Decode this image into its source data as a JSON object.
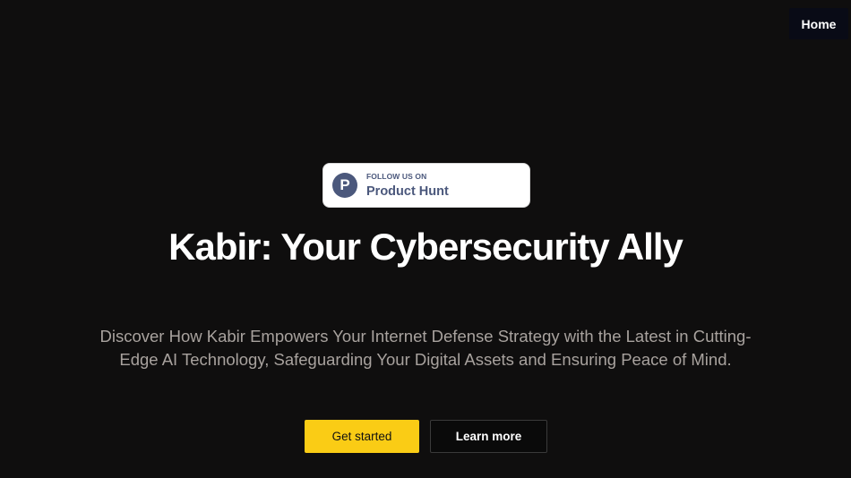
{
  "nav": {
    "home_label": "Home"
  },
  "badge": {
    "logo_letter": "P",
    "small_label": "FOLLOW US ON",
    "big_label": "Product Hunt",
    "icon": "product-hunt-icon"
  },
  "hero": {
    "title": "Kabir: Your Cybersecurity Ally",
    "subtitle": "Discover How Kabir Empowers Your Internet Defense Strategy with the Latest in Cutting-Edge AI Technology, Safeguarding Your Digital Assets and Ensuring Peace of Mind."
  },
  "actions": {
    "primary_label": "Get started",
    "secondary_label": "Learn more"
  },
  "colors": {
    "background": "#0f0e0e",
    "accent": "#facc15",
    "badge_text": "#4b587c",
    "subtitle_text": "#a8a29e"
  }
}
